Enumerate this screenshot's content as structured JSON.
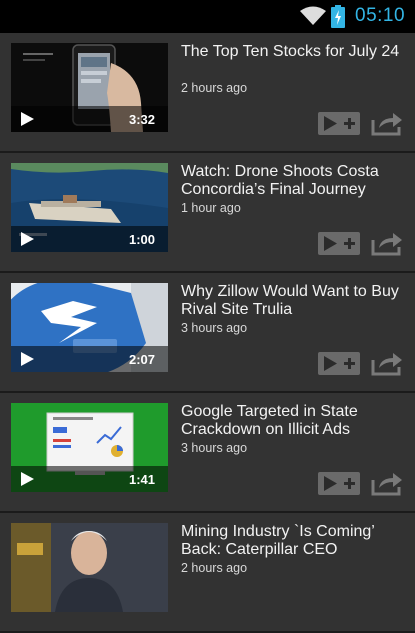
{
  "status_bar": {
    "time": "05:10",
    "icons": [
      "wifi-icon",
      "battery-charging-icon"
    ],
    "accent_color": "#33b5e5"
  },
  "videos": [
    {
      "title": "The Top Ten Stocks for July 24",
      "age": "2 hours ago",
      "duration": "3:32",
      "thumb_icon": "smartphone-hand-thumbnail"
    },
    {
      "title": "Watch: Drone Shoots Costa Concordia’s Final Journey",
      "age": "1 hour ago",
      "duration": "1:00",
      "thumb_icon": "ship-at-sea-thumbnail"
    },
    {
      "title": "Why Zillow Would Want to Buy Rival Site Trulia",
      "age": "3 hours ago",
      "duration": "2:07",
      "thumb_icon": "zillow-logo-thumbnail"
    },
    {
      "title": "Google Targeted in State Crackdown on Illicit Ads",
      "age": "3 hours ago",
      "duration": "1:41",
      "thumb_icon": "google-adwords-thumbnail"
    },
    {
      "title": "Mining Industry `Is Coming’ Back: Caterpillar CEO",
      "age": "2 hours ago",
      "duration": "",
      "thumb_icon": "ceo-portrait-thumbnail"
    }
  ],
  "actions": {
    "add_icon": "add-to-playlist-icon",
    "share_icon": "share-icon"
  }
}
